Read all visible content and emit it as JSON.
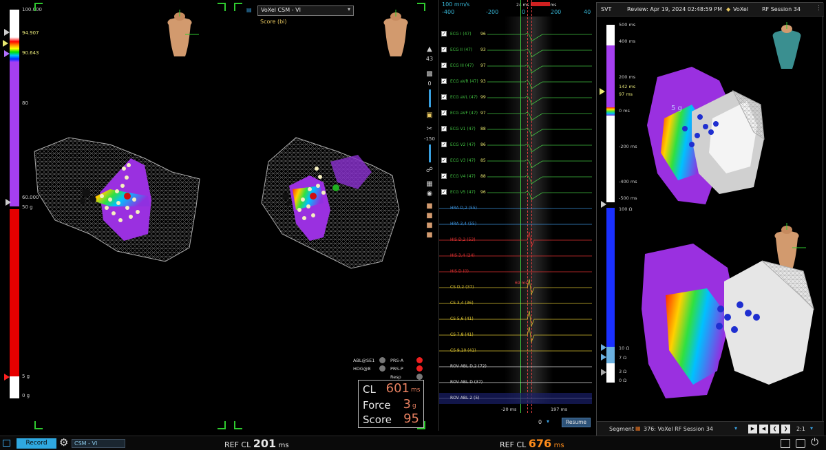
{
  "left_scale": {
    "top_value": "100.000",
    "upper_marker": "94.907",
    "lower_marker": "90.643",
    "mid_value": "80",
    "bottom_value": "60.000",
    "force_top": "50 g",
    "force_marker": "5 g",
    "force_bottom": "0 g"
  },
  "map_selector": {
    "value": "VoXel CSM - VI",
    "subtitle": "Score (bi)"
  },
  "indicators": [
    {
      "label": "ABL@SE1",
      "color": "#777777"
    },
    {
      "label": "PRS-A",
      "color": "#ee2020"
    },
    {
      "label": "HDG@8",
      "color": "#777777"
    },
    {
      "label": "PRS-P",
      "color": "#ee2020"
    },
    {
      "label": "Resp",
      "color": "#777777"
    }
  ],
  "metrics": {
    "cl_label": "CL",
    "cl_value": "601",
    "cl_unit": "ms",
    "force_label": "Force",
    "force_value": "3",
    "force_unit": "g",
    "score_label": "Score",
    "score_value": "95"
  },
  "tools": {
    "value_43": "43",
    "value_0": "0",
    "value_minus150": "-150"
  },
  "waveform": {
    "speed": "100 mm/s",
    "ticks": [
      "-400",
      "-200",
      "0",
      "200",
      "40"
    ],
    "marker_left": "24 ms",
    "marker_right": "170 ms",
    "caliper": "69 ms",
    "foot_left": "-20 ms",
    "foot_right": "197 ms",
    "offset_value": "0",
    "resume": "Resume",
    "channels": [
      {
        "name": "ECG I (47)",
        "value": "96",
        "color": "#40c040",
        "checked": true
      },
      {
        "name": "ECG II (47)",
        "value": "93",
        "color": "#40c040",
        "checked": true
      },
      {
        "name": "ECG III (47)",
        "value": "97",
        "color": "#40c040",
        "checked": true
      },
      {
        "name": "ECG aVR (47)",
        "value": "93",
        "color": "#40c040",
        "checked": true
      },
      {
        "name": "ECG aVL (47)",
        "value": "99",
        "color": "#40c040",
        "checked": true
      },
      {
        "name": "ECG aVF (47)",
        "value": "97",
        "color": "#40c040",
        "checked": true
      },
      {
        "name": "ECG V1 (47)",
        "value": "88",
        "color": "#40c040",
        "checked": true
      },
      {
        "name": "ECG V2 (47)",
        "value": "86",
        "color": "#40c040",
        "checked": true
      },
      {
        "name": "ECG V3 (47)",
        "value": "85",
        "color": "#40c040",
        "checked": true
      },
      {
        "name": "ECG V4 (47)",
        "value": "88",
        "color": "#40c040",
        "checked": true
      },
      {
        "name": "ECG V5 (47)",
        "value": "96",
        "color": "#40c040",
        "checked": true
      },
      {
        "name": "HRA D,2 (55)",
        "value": "",
        "color": "#3a8fd8",
        "checked": false
      },
      {
        "name": "HRA 3,4 (55)",
        "value": "",
        "color": "#3a8fd8",
        "checked": false
      },
      {
        "name": "HIS D,2 (53)",
        "value": "",
        "color": "#e03030",
        "checked": false
      },
      {
        "name": "HIS 3,4 (24)",
        "value": "",
        "color": "#e03030",
        "checked": false
      },
      {
        "name": "HIS D (0)",
        "value": "",
        "color": "#e03030",
        "checked": false
      },
      {
        "name": "CS D,2 (37)",
        "value": "",
        "color": "#d8c030",
        "checked": false
      },
      {
        "name": "CS 3,4 (36)",
        "value": "",
        "color": "#d8c030",
        "checked": false
      },
      {
        "name": "CS 5,6 (41)",
        "value": "",
        "color": "#d8c030",
        "checked": false
      },
      {
        "name": "CS 7,8 (41)",
        "value": "",
        "color": "#d8c030",
        "checked": false
      },
      {
        "name": "CS 9,10 (41)",
        "value": "",
        "color": "#d8c030",
        "checked": false
      },
      {
        "name": "ROV ABL D,2 (72)",
        "value": "",
        "color": "#dddddd",
        "checked": false
      },
      {
        "name": "ROV ABL D (37)",
        "value": "",
        "color": "#dddddd",
        "checked": false
      },
      {
        "name": "ROV ABL 2 (5)",
        "value": "",
        "color": "#dddddd",
        "checked": false
      }
    ]
  },
  "right_panel": {
    "tab": "SVT",
    "review": "Review: Apr 19, 2024 02:48:59 PM",
    "voxel": "VoXel",
    "session": "RF Session 34",
    "lat_labels": {
      "top": "500 ms",
      "l400": "400 ms",
      "l200": "200 ms",
      "m142": "142 ms",
      "m97": "97 ms",
      "l0": "0 ms",
      "lm200": "-200 ms",
      "lm400": "-400 ms",
      "bottom": "-500 ms"
    },
    "imp_labels": {
      "top": "100 Ω",
      "i10": "10 Ω",
      "i7": "7 Ω",
      "i3": "3 Ω",
      "bottom": "0 Ω"
    },
    "force_tag": "5 g",
    "segment_label": "Segment",
    "segment_value": "376: VoXel RF Session 34",
    "speed": "2:1"
  },
  "bottom_bar": {
    "record": "Record",
    "config": "CSM - VI",
    "ref1_label": "REF  CL",
    "ref1_value": "201",
    "ref1_unit": "ms",
    "ref2_label": "REF  CL",
    "ref2_value": "676",
    "ref2_unit": "ms"
  }
}
